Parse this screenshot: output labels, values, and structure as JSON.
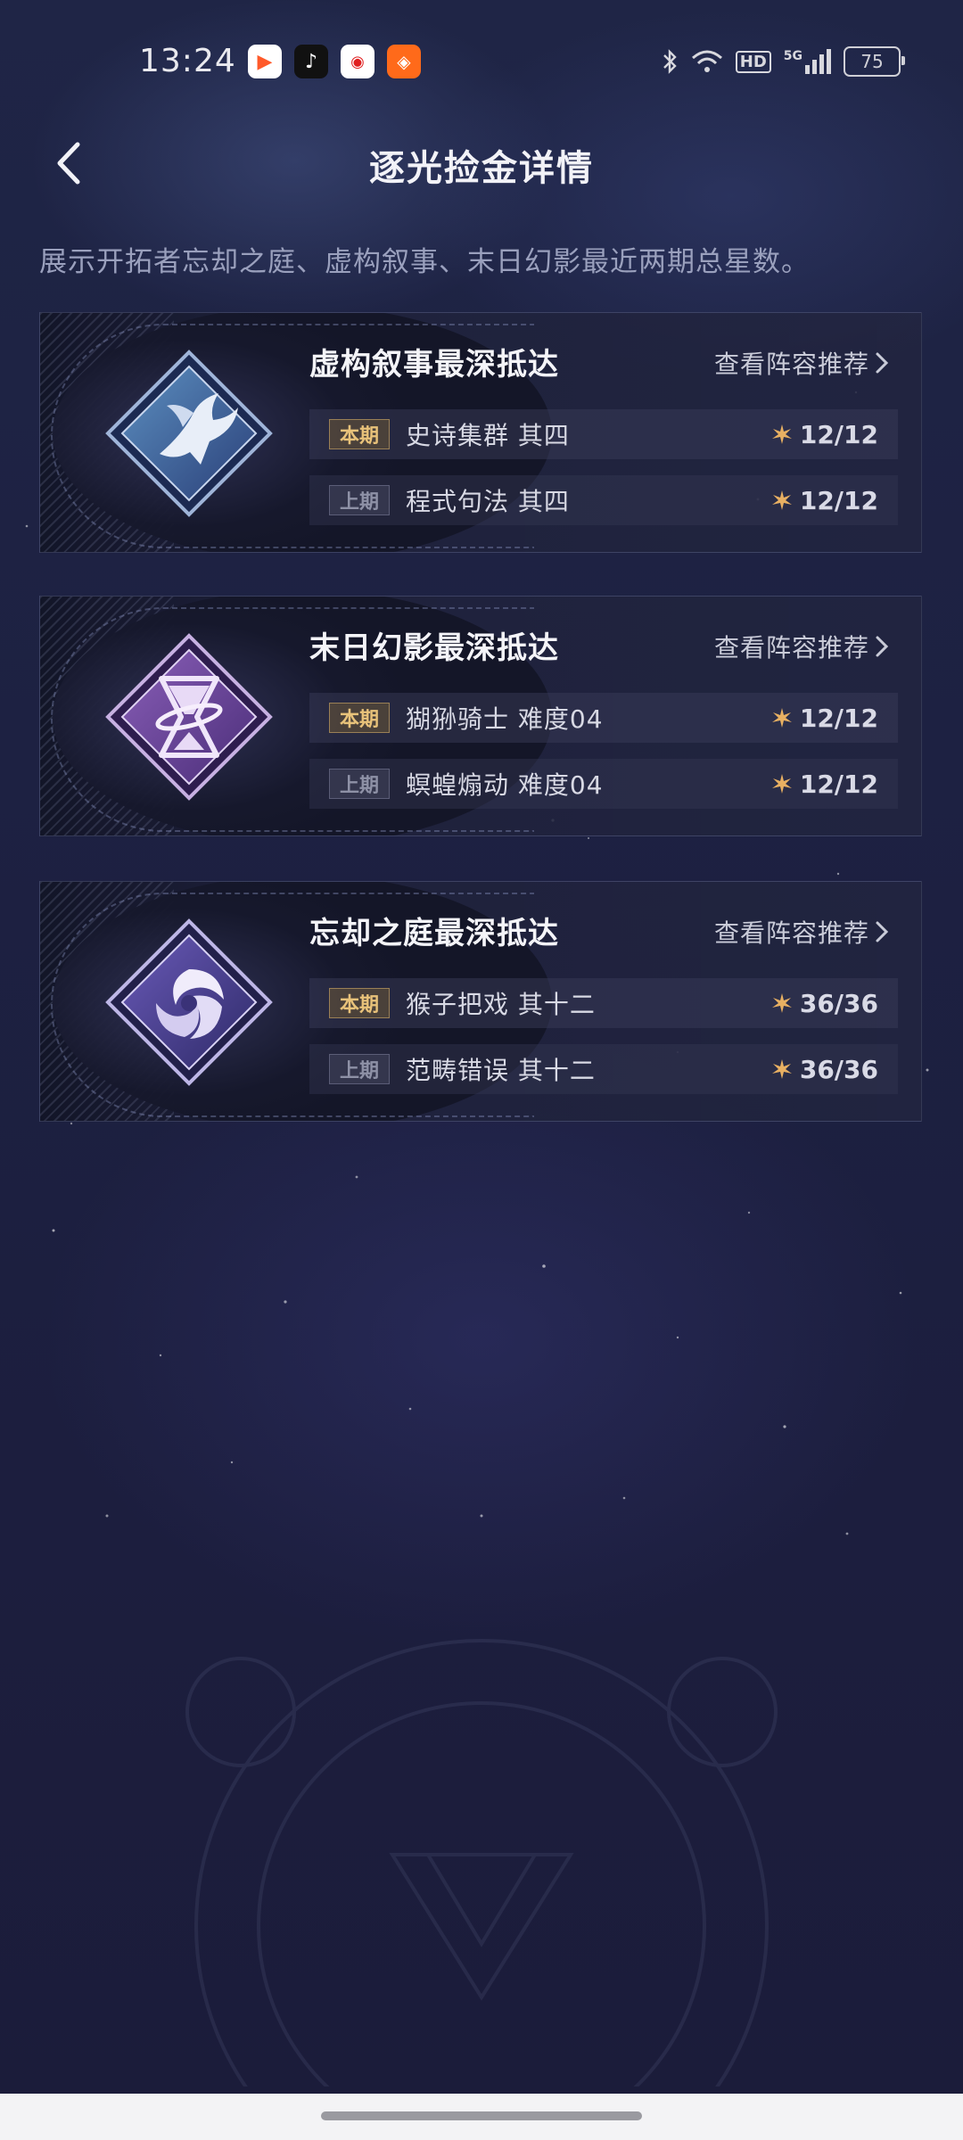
{
  "status_bar": {
    "time": "13:24",
    "battery": "75",
    "net_label": "5G",
    "hd_label": "HD",
    "apps": [
      "video-app-icon",
      "tiktok-icon",
      "map-app-icon",
      "store-app-icon"
    ],
    "icons": [
      "bluetooth-icon",
      "wifi-icon",
      "hd-icon",
      "signal-icon",
      "battery-icon"
    ]
  },
  "header": {
    "title": "逐光捡金详情",
    "back_icon": "chevron-left-icon"
  },
  "description": "展示开拓者忘却之庭、虚构叙事、末日幻影最近两期总星数。",
  "cards": [
    {
      "title": "虚构叙事最深抵达",
      "link": "查看阵容推荐",
      "emblem": "bird-emblem-icon",
      "rows": [
        {
          "badge": "本期",
          "stage": "史诗集群 其四",
          "stars": "12/12"
        },
        {
          "badge": "上期",
          "stage": "程式句法 其四",
          "stars": "12/12"
        }
      ]
    },
    {
      "title": "末日幻影最深抵达",
      "link": "查看阵容推荐",
      "emblem": "hourglass-emblem-icon",
      "rows": [
        {
          "badge": "本期",
          "stage": "猢狲骑士 难度04",
          "stars": "12/12"
        },
        {
          "badge": "上期",
          "stage": "螟蝗煽动 难度04",
          "stars": "12/12"
        }
      ]
    },
    {
      "title": "忘却之庭最深抵达",
      "link": "查看阵容推荐",
      "emblem": "swirl-emblem-icon",
      "rows": [
        {
          "badge": "本期",
          "stage": "猴子把戏 其十二",
          "stars": "36/36"
        },
        {
          "badge": "上期",
          "stage": "范畴错误 其十二",
          "stars": "36/36"
        }
      ]
    }
  ],
  "colors": {
    "accent_gold": "#e8c27a",
    "background": "#1d2142",
    "emblem_purple": "#7a5bb0"
  }
}
